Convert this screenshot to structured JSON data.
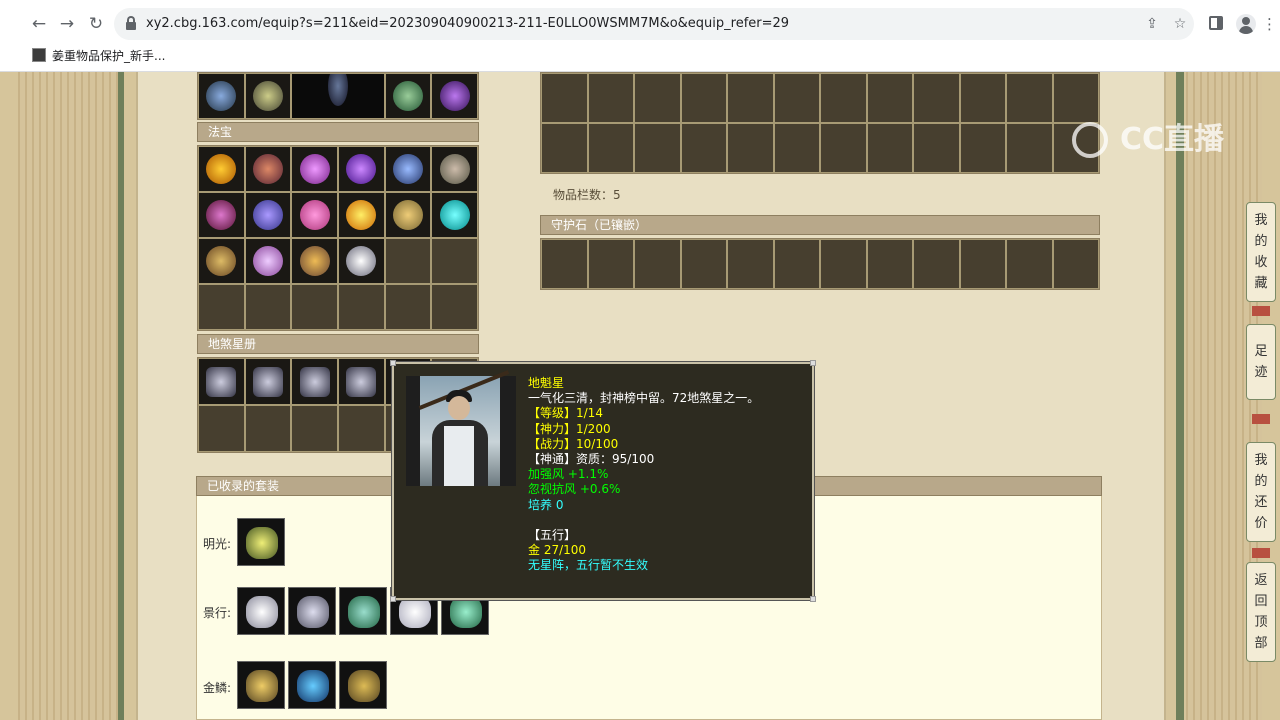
{
  "browser": {
    "url": "xy2.cbg.163.com/equip?s=211&eid=202309040900213-211-E0LLO0WSMM7M&o&equip_refer=29",
    "bookmark_label": "姜重物品保护_新手..."
  },
  "watermark": {
    "text": "CC直播"
  },
  "sections": {
    "fabao_title": "法宝",
    "disha_title": "地煞星册",
    "guard_title": "守护石（已镶嵌）",
    "inventory_count": "物品栏数：5",
    "suits_title": "已收录的套装"
  },
  "suits": [
    {
      "label": "明光:",
      "count": 1
    },
    {
      "label": "景行:",
      "count": 5
    },
    {
      "label": "金鳞:",
      "count": 3
    }
  ],
  "tooltip": {
    "name": "地魁星",
    "desc": "一气化三清，封神榜中留。72地煞星之一。",
    "level": "【等级】1/14",
    "shenli": "【神力】1/200",
    "zhanli": "【战力】10/100",
    "shentong": "【神通】资质：95/100",
    "attr1": "加强风 +1.1%",
    "attr2": "忽视抗风 +0.6%",
    "peiyang": "培养 0",
    "wuxing_title": "【五行】",
    "wuxing_value": "金 27/100",
    "wuxing_note": "无星阵，五行暂不生效"
  },
  "float_nav": [
    {
      "label": "我的收藏",
      "chars": [
        "我",
        "的",
        "收",
        "藏"
      ]
    },
    {
      "label": "足迹",
      "chars": [
        "足",
        "迹"
      ]
    },
    {
      "label": "我的还价",
      "chars": [
        "我",
        "的",
        "还",
        "价"
      ]
    },
    {
      "label": "返回顶部",
      "chars": [
        "返",
        "回",
        "顶",
        "部"
      ]
    }
  ],
  "colors": {
    "tooltip_bg": "#2d2b20",
    "yellow": "#ffff00",
    "green": "#00ff00",
    "cyan": "#33ffff",
    "slot_bg": "#473f2f"
  }
}
